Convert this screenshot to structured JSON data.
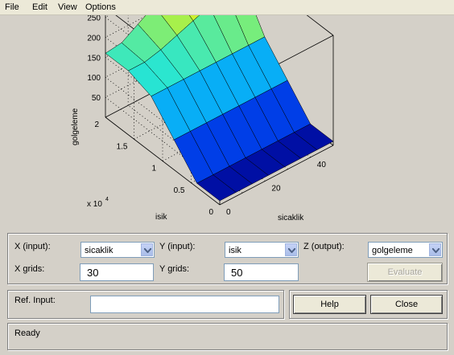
{
  "menu": [
    "File",
    "Edit",
    "View",
    "Options"
  ],
  "chart_data": {
    "type": "surface",
    "zlabel": "golgeleme",
    "xlabel": "sicaklik",
    "ylabel": "isik",
    "z_ticks": [
      "50",
      "100",
      "150",
      "200",
      "250"
    ],
    "x_ticks": [
      "0",
      "20",
      "40"
    ],
    "y_ticks": [
      "0",
      "0.5",
      "1",
      "1.5",
      "2"
    ],
    "y_multiplier": "x 10",
    "y_multiplier_exp": "4",
    "xlim": [
      0,
      50
    ],
    "ylim": [
      0,
      20000
    ],
    "zlim": [
      0,
      275
    ],
    "surface_rows_by_isik": [
      [
        10,
        10,
        10,
        10,
        10,
        10,
        10,
        10
      ],
      [
        10,
        10,
        10,
        10,
        10,
        10,
        10,
        10
      ],
      [
        75,
        75,
        75,
        75,
        75,
        75,
        75,
        75
      ],
      [
        140,
        140,
        140,
        140,
        140,
        140,
        140,
        140
      ],
      [
        160,
        160,
        170,
        185,
        200,
        215,
        230,
        240
      ],
      [
        160,
        165,
        190,
        215,
        240,
        260,
        272,
        275
      ]
    ]
  },
  "controls": {
    "x_input_label": "X (input):",
    "x_input_value": "sicaklik",
    "y_input_label": "Y (input):",
    "y_input_value": "isik",
    "z_output_label": "Z (output):",
    "z_output_value": "golgeleme",
    "x_grids_label": "X grids:",
    "x_grids_value": "30",
    "y_grids_label": "Y grids:",
    "y_grids_value": "50",
    "evaluate_label": "Evaluate"
  },
  "ref": {
    "label": "Ref. Input:",
    "value": "",
    "help_label": "Help",
    "close_label": "Close"
  },
  "status": {
    "text": "Ready"
  },
  "colors": {
    "window_bg": "#d4d0c8",
    "menubar_bg": "#ece9d8",
    "input_border": "#7f9db9"
  }
}
